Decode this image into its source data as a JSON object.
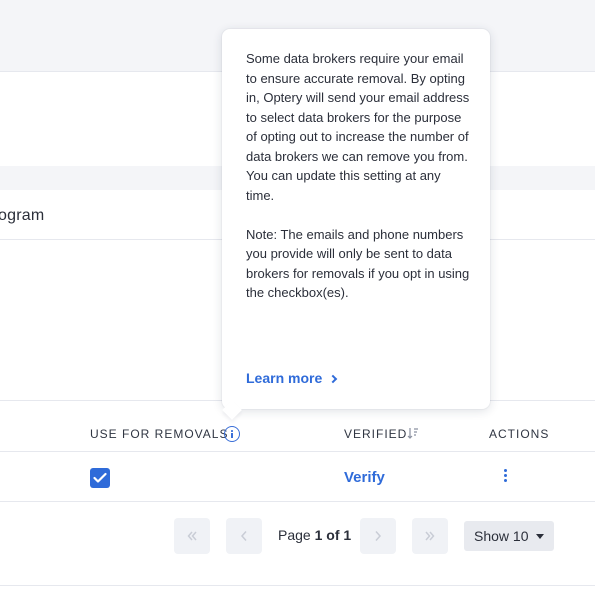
{
  "section": {
    "partial_title": "ogram"
  },
  "table": {
    "columns": {
      "use_for_removals": "USE FOR REMOVALS",
      "verified": "VERIFIED",
      "actions": "ACTIONS"
    },
    "rows": [
      {
        "use_for_removals_checked": true,
        "verified_action": "Verify"
      }
    ]
  },
  "pagination": {
    "page_prefix": "Page ",
    "page_current": "1 of 1",
    "show_label": "Show 10"
  },
  "tooltip": {
    "paragraph1": "Some data brokers require your email to ensure accurate removal. By opting in, Optery will send your email address to select data brokers for the purpose of opting out to increase the number of data brokers we can remove you from. You can update this setting at any time.",
    "paragraph2": "Note: The emails and phone numbers you provide will only be sent to data brokers for removals if you opt in using the checkbox(es).",
    "link": "Learn more"
  },
  "colors": {
    "accent": "#2f6bd9",
    "band": "#f4f5f8"
  }
}
